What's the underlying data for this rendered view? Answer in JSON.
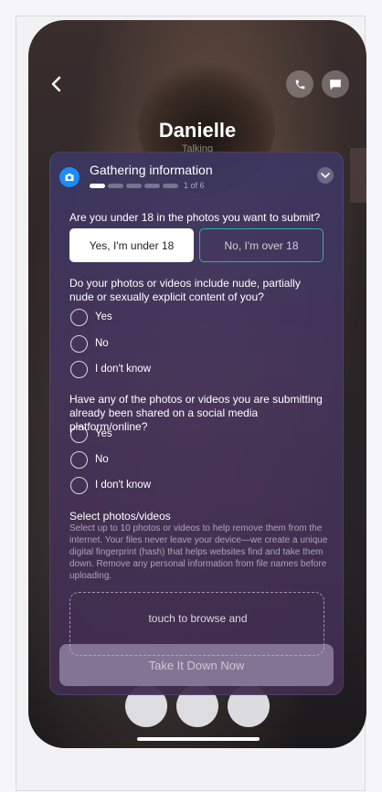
{
  "contact": {
    "name": "Danielle",
    "status": "Talking"
  },
  "sheet": {
    "title": "Gathering information",
    "progress": {
      "current": 1,
      "total": 6,
      "label": "1 of 6"
    },
    "q1": {
      "text": "Are you under 18 in the photos you want to submit?",
      "yes_label": "Yes, I'm under 18",
      "no_label": "No, I'm over 18",
      "selected": "yes"
    },
    "q2": {
      "text": "Do your photos or videos include nude, partially nude or sexually explicit content of you?",
      "options": [
        "Yes",
        "No",
        "I don't know"
      ]
    },
    "q3": {
      "text": "Have any of the photos or videos you are submitting already been shared on a social media platform/online?",
      "options": [
        "Yes",
        "No",
        "I don't know"
      ]
    },
    "select": {
      "title": "Select photos/videos",
      "description": "Select up to 10 photos or videos to help remove them from the internet. Your files never leave your device—we create a unique digital fingerprint (hash) that helps websites find and take them down. Remove any personal information from file names before uploading.",
      "dropzone_text": "touch to browse and"
    },
    "submit_label": "Take It Down Now"
  },
  "colors": {
    "accent_blue": "#1d8cf8",
    "teal_border": "#2fb0a5",
    "sheet_bg": "#3c3762"
  },
  "icons": [
    "back-icon",
    "phone-icon",
    "message-icon",
    "camera-icon",
    "chevron-down-icon"
  ]
}
